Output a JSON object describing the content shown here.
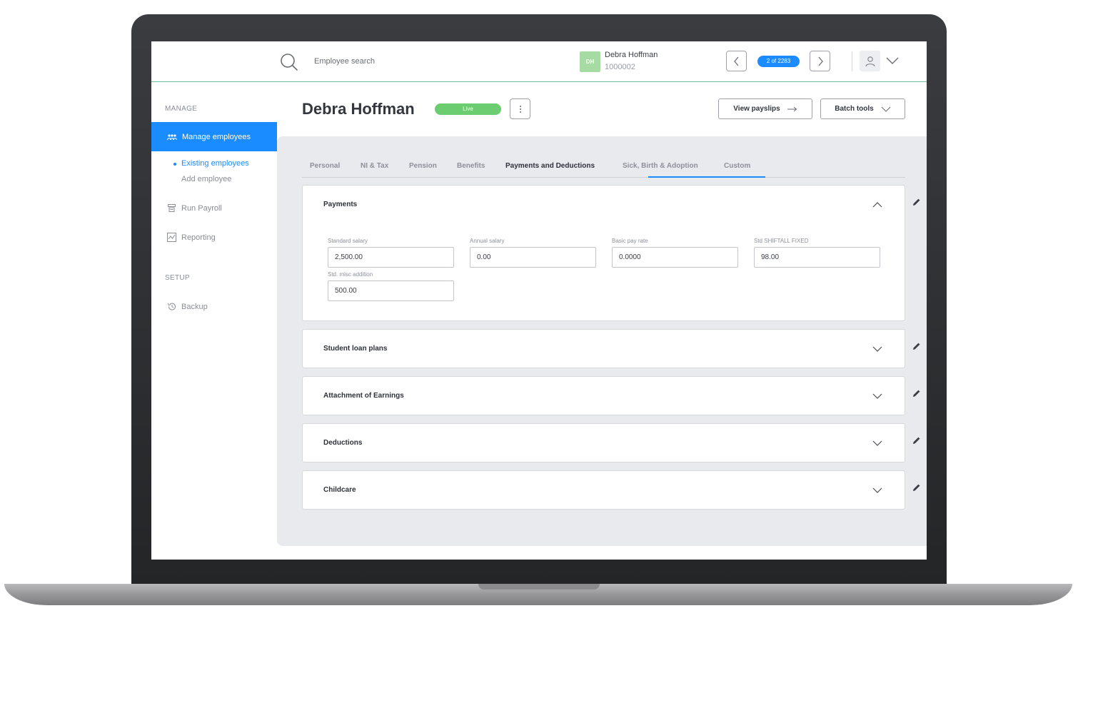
{
  "search": {
    "placeholder": "Employee search"
  },
  "employee": {
    "initials": "DH",
    "name": "Debra Hoffman",
    "id": "1000002"
  },
  "pager": {
    "label": "2 of 2283"
  },
  "sidebar": {
    "manage_heading": "MANAGE",
    "active_item": "Manage employees",
    "sub_items": [
      "Existing employees",
      "Add employee"
    ],
    "items": [
      "Run Payroll",
      "Reporting"
    ],
    "setup_heading": "SETUP",
    "setup_items": [
      "Backup"
    ]
  },
  "header": {
    "title": "Debra Hoffman",
    "status": "Live",
    "view_payslips": "View payslips",
    "batch_tools": "Batch tools"
  },
  "tabs": [
    "Personal",
    "NI & Tax",
    "Pension",
    "Benefits",
    "Payments and Deductions",
    "Sick, Birth & Adoption",
    "Custom"
  ],
  "active_tab": "Payments and Deductions",
  "payments": {
    "title": "Payments",
    "fields": [
      {
        "label": "Standard salary",
        "value": "2,500.00"
      },
      {
        "label": "Annual salary",
        "value": "0.00"
      },
      {
        "label": "Basic pay rate",
        "value": "0.0000"
      },
      {
        "label": "Std SHIFTALL FIXED",
        "value": "98.00"
      },
      {
        "label": "Std. misc addition",
        "value": "500.00"
      }
    ]
  },
  "sections": [
    "Student loan plans",
    "Attachment of Earnings",
    "Deductions",
    "Childcare"
  ],
  "colors": {
    "accent": "#1a8cff",
    "live": "#6ccd70",
    "avatar": "#a6dba3",
    "panel": "#e9eaee"
  }
}
